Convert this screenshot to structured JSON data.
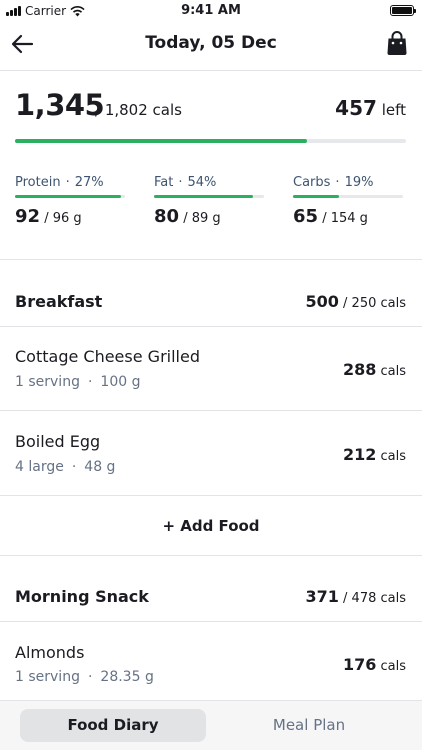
{
  "status_bar": {
    "carrier": "Carrier",
    "time": "9:41 AM"
  },
  "nav": {
    "title": "Today, 05 Dec",
    "back_icon": "arrow-left-icon",
    "bag_icon": "shopping-bag-icon"
  },
  "summary": {
    "consumed": "1,345",
    "goal": "/ 1,802 cals",
    "left_value": "457",
    "left_label": "left",
    "progress_fraction": 0.746
  },
  "macros": [
    {
      "name": "Protein",
      "percent": "27%",
      "value": "92",
      "goal": "/ 96 g",
      "fill_fraction": 0.96
    },
    {
      "name": "Fat",
      "percent": "54%",
      "value": "80",
      "goal": "/ 89 g",
      "fill_fraction": 0.9
    },
    {
      "name": "Carbs",
      "percent": "19%",
      "value": "65",
      "goal": "/ 154 g",
      "fill_fraction": 0.42
    }
  ],
  "sections": [
    {
      "title": "Breakfast",
      "cal_value": "500",
      "cal_goal": "/ 250 cals",
      "foods": [
        {
          "name": "Cottage Cheese Grilled",
          "amount": "1 serving",
          "weight": "100 g",
          "cals": "288",
          "unit": "cals"
        },
        {
          "name": "Boiled Egg",
          "amount": "4 large",
          "weight": "48 g",
          "cals": "212",
          "unit": "cals"
        }
      ],
      "add_label": "+ Add Food"
    },
    {
      "title": "Morning Snack",
      "cal_value": "371",
      "cal_goal": "/ 478 cals",
      "foods": [
        {
          "name": "Almonds",
          "amount": "1 serving",
          "weight": "28.35 g",
          "cals": "176",
          "unit": "cals"
        }
      ]
    }
  ],
  "tabs": [
    {
      "label": "Food Diary",
      "active": true
    },
    {
      "label": "Meal Plan",
      "active": false
    }
  ],
  "colors": {
    "accent_green": "#2bb062",
    "muted_text": "#667285",
    "track": "#e6e8eb"
  }
}
